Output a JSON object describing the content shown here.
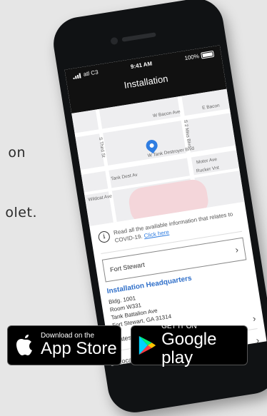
{
  "background": {
    "line1": "on",
    "line2": "olet."
  },
  "phone": {
    "status": {
      "carrier": "atl C3",
      "time": "9:41 AM",
      "battery": "100%"
    },
    "title": "Installation",
    "map": {
      "labels": [
        "W Bacon Ave",
        "E Bacon",
        "S Third St",
        "S 2 Miss Blvd",
        "W Tank Destroyer Blvd",
        "Motor Ave",
        "Rucker Vnt",
        "Tank Dest Av",
        "Wildcat Ave"
      ]
    },
    "covid": {
      "text": "Read all the available information that relates to COVID-19.",
      "link": "Click here"
    },
    "installation_select": "Fort Stewart",
    "hq": {
      "title": "Installation Headquarters",
      "lines": [
        "Bldg. 1001",
        "Room W331",
        "Tank Battalion Ave",
        "Fort Stewart, GA 31314"
      ]
    },
    "rows": [
      "Dates Information",
      "Locati"
    ]
  },
  "stores": {
    "apple_small": "Download on the",
    "apple_big": "App Store",
    "google_small": "GET IT ON",
    "google_big": "Google play"
  },
  "colors": {
    "accent": "#2f7de1",
    "header": "#111111"
  }
}
